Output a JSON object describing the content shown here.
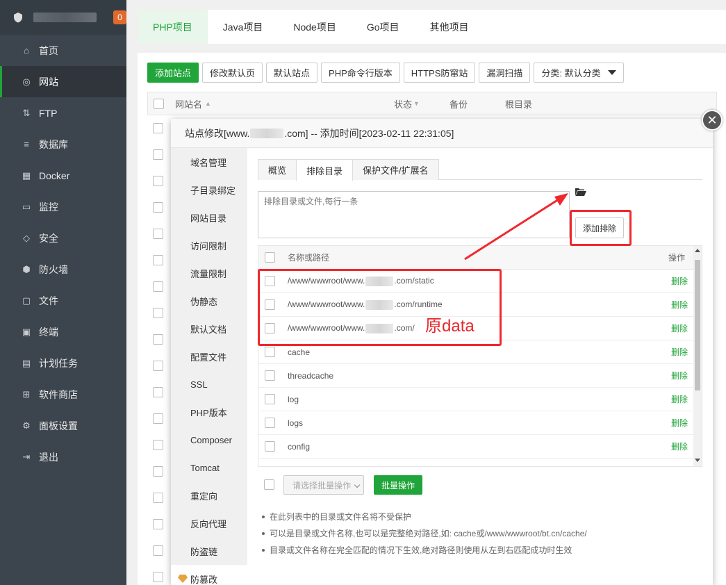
{
  "sidebar": {
    "badge": "0",
    "items": [
      {
        "label": "首页",
        "icon": "home-icon"
      },
      {
        "label": "网站",
        "icon": "globe-icon"
      },
      {
        "label": "FTP",
        "icon": "ftp-icon"
      },
      {
        "label": "数据库",
        "icon": "database-icon"
      },
      {
        "label": "Docker",
        "icon": "docker-icon"
      },
      {
        "label": "监控",
        "icon": "monitor-icon"
      },
      {
        "label": "安全",
        "icon": "shield-icon"
      },
      {
        "label": "防火墙",
        "icon": "firewall-icon"
      },
      {
        "label": "文件",
        "icon": "folder-icon"
      },
      {
        "label": "终端",
        "icon": "terminal-icon"
      },
      {
        "label": "计划任务",
        "icon": "calendar-icon"
      },
      {
        "label": "软件商店",
        "icon": "apps-icon"
      },
      {
        "label": "面板设置",
        "icon": "gear-icon"
      },
      {
        "label": "退出",
        "icon": "logout-icon"
      }
    ],
    "active_index": 1
  },
  "main_tabs": [
    "PHP项目",
    "Java项目",
    "Node项目",
    "Go项目",
    "其他项目"
  ],
  "toolbar": {
    "add_site": "添加站点",
    "modify_default_page": "修改默认页",
    "default_site": "默认站点",
    "php_cli_version": "PHP命令行版本",
    "https_protection": "HTTPS防窜站",
    "vuln_scan": "漏洞扫描",
    "category_select": "分类: 默认分类"
  },
  "site_table": {
    "columns": [
      "网站名",
      "状态",
      "备份",
      "根目录"
    ]
  },
  "modal": {
    "title_prefix": "站点修改[www.",
    "title_suffix": ".com] -- 添加时间[2023-02-11 22:31:05]",
    "side_items": [
      "域名管理",
      "子目录绑定",
      "网站目录",
      "访问限制",
      "流量限制",
      "伪静态",
      "默认文档",
      "配置文件",
      "SSL",
      "PHP版本",
      "Composer",
      "Tomcat",
      "重定向",
      "反向代理",
      "防盗链",
      "防篡改"
    ],
    "sub_tabs": [
      "概览",
      "排除目录",
      "保护文件/扩展名"
    ],
    "active_sub_tab": 1,
    "textarea_placeholder": "排除目录或文件,每行一条",
    "add_exclusion_button": "添加排除",
    "list_header": {
      "name": "名称或路径",
      "action": "操作"
    },
    "rows": [
      {
        "prefix": "/www/wwwroot/www.",
        "suffix": ".com/static",
        "blurred": true
      },
      {
        "prefix": "/www/wwwroot/www.",
        "suffix": ".com/runtime",
        "blurred": true
      },
      {
        "prefix": "/www/wwwroot/www.",
        "suffix": ".com/",
        "blurred": true
      },
      {
        "prefix": "cache",
        "suffix": "",
        "blurred": false
      },
      {
        "prefix": "threadcache",
        "suffix": "",
        "blurred": false
      },
      {
        "prefix": "log",
        "suffix": "",
        "blurred": false
      },
      {
        "prefix": "logs",
        "suffix": "",
        "blurred": false
      },
      {
        "prefix": "config",
        "suffix": "",
        "blurred": false
      }
    ],
    "delete_label": "删除",
    "batch_select_placeholder": "请选择批量操作",
    "batch_button": "批量操作",
    "tips": [
      "在此列表中的目录或文件名将不受保护",
      "可以是目录或文件名称,也可以是完整绝对路径,如: cache或/www/wwwroot/bt.cn/cache/",
      "目录或文件名称在完全匹配的情况下生效,绝对路径则使用从左到右匹配成功时生效"
    ]
  },
  "annotation": {
    "label": "原data",
    "color": "#f0282d"
  },
  "colors": {
    "accent": "#20a53a",
    "sidebar_bg": "#3c444d",
    "badge": "#e06a2e"
  }
}
